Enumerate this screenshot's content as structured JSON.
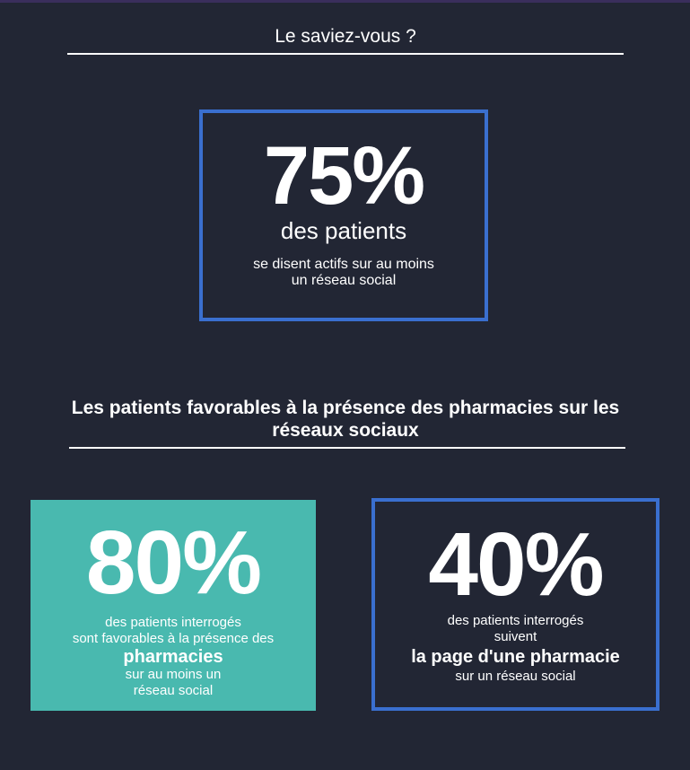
{
  "header": {
    "title": "Le saviez-vous ?"
  },
  "stat_main": {
    "value": "75%",
    "subtitle": "des patients",
    "detail_line1": "se disent actifs sur au moins",
    "detail_line2": "un réseau social"
  },
  "section2": {
    "title_line1": "Les patients favorables à la présence des pharmacies sur les",
    "title_line2": "réseaux sociaux"
  },
  "stat_left": {
    "value": "80%",
    "line1": "des patients interrogés",
    "line2": "sont favorables à la présence des",
    "emphasis": "pharmacies",
    "line3": "sur au moins un",
    "line4": "réseau social"
  },
  "stat_right": {
    "value": "40%",
    "line1": "des patients interrogés",
    "line2": "suivent",
    "emphasis": "la page d'une pharmacie",
    "line3": "sur un réseau social"
  },
  "colors": {
    "background": "#222634",
    "accent_blue": "#3a6fcf",
    "teal": "#49b9af",
    "text": "#ffffff"
  }
}
